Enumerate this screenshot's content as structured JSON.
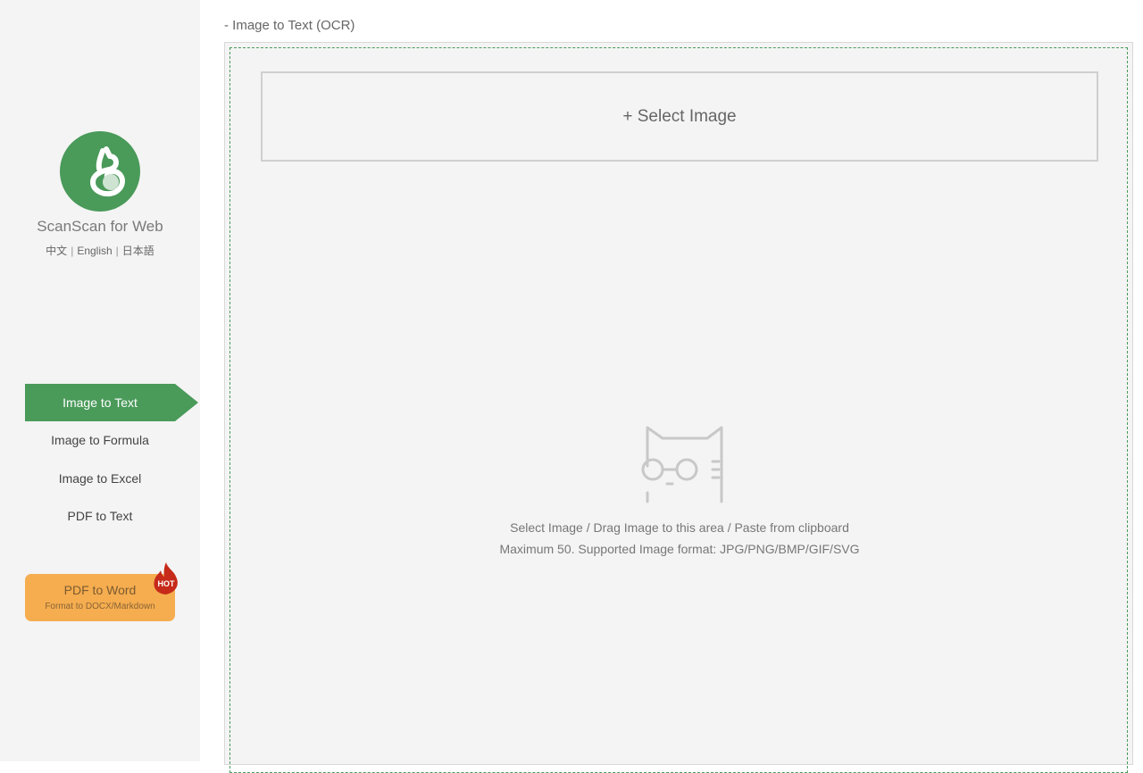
{
  "sidebar": {
    "app_name": "ScanScan for Web",
    "languages": [
      "中文",
      "English",
      "日本語"
    ],
    "logo_icon": "scanscan-cat-logo-icon",
    "nav": [
      {
        "label": "Image to Text",
        "active": true
      },
      {
        "label": "Image to Formula",
        "active": false
      },
      {
        "label": "Image to Excel",
        "active": false
      },
      {
        "label": "PDF to Text",
        "active": false
      }
    ],
    "promo": {
      "title": "PDF to Word",
      "subtitle": "Format to DOCX/Markdown",
      "badge": "HOT"
    }
  },
  "main": {
    "title": "- Image to Text (OCR)",
    "select_button": "+ Select Image",
    "placeholder_icon": "cat-with-glasses-icon",
    "hint_line1": "Select Image / Drag Image to this area / Paste from clipboard",
    "hint_line2": "Maximum 50. Supported Image format: JPG/PNG/BMP/GIF/SVG"
  },
  "colors": {
    "brand_green": "#4a9a5a",
    "promo_orange": "#f5ad4f",
    "hot_red": "#c62a1a"
  }
}
